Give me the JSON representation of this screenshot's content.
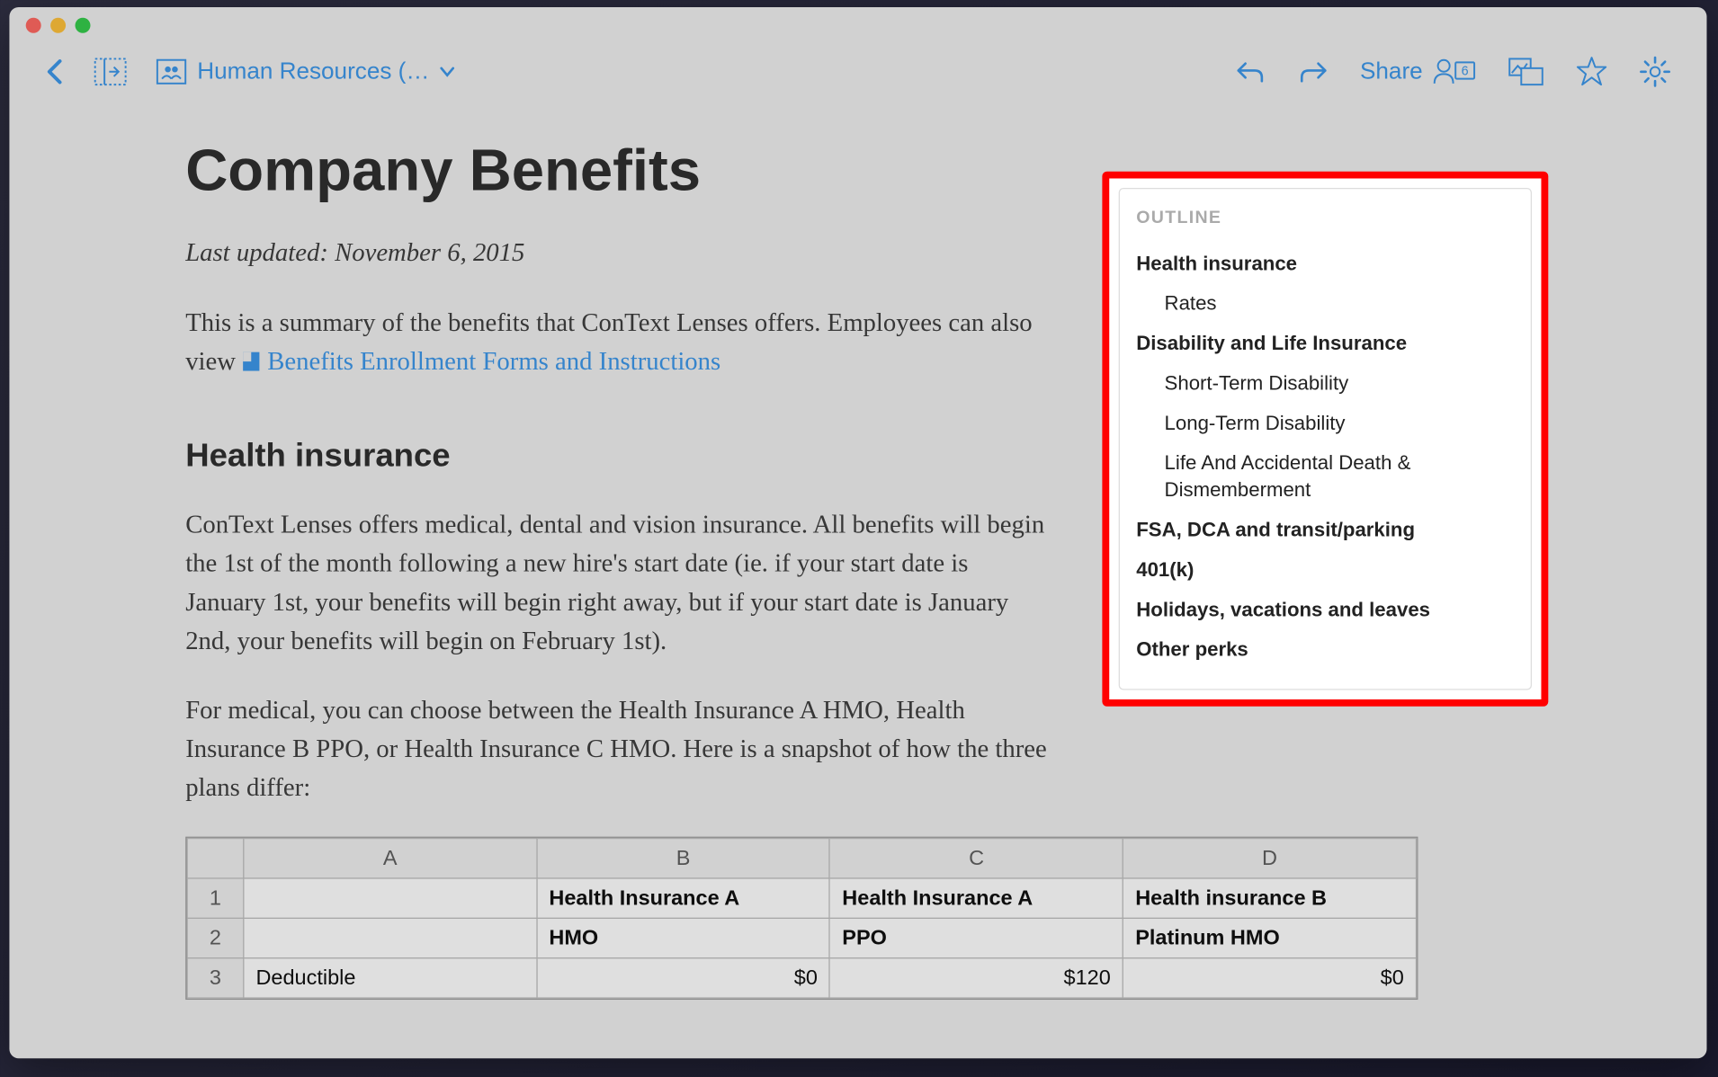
{
  "toolbar": {
    "breadcrumb": "Human Resources (…",
    "share_label": "Share",
    "share_count": "6"
  },
  "document": {
    "title": "Company Benefits",
    "last_updated": "Last updated: November 6, 2015",
    "intro_text_before": "This is a summary of the benefits that ConText Lenses offers. Employees can also view ",
    "intro_link": "Benefits Enrollment Forms and Instructions",
    "section1_heading": "Health insurance",
    "section1_p1": "ConText Lenses offers medical, dental and vision insurance. All benefits will begin the 1st of the month following a new hire's start date (ie. if your start date is January 1st, your benefits will begin right away, but if your start date is January 2nd, your benefits will begin on February 1st).",
    "section1_p2": "For medical, you can choose between the Health Insurance A HMO, Health Insurance B PPO, or Health Insurance C HMO. Here is a snapshot of how the three plans differ:"
  },
  "outline": {
    "title": "OUTLINE",
    "items": [
      {
        "label": "Health insurance",
        "level": 1
      },
      {
        "label": "Rates",
        "level": 2
      },
      {
        "label": "Disability and Life Insurance",
        "level": 1
      },
      {
        "label": "Short-Term Disability",
        "level": 2
      },
      {
        "label": "Long-Term Disability",
        "level": 2
      },
      {
        "label": "Life And Accidental Death & Dismemberment",
        "level": 2
      },
      {
        "label": "FSA, DCA and transit/parking",
        "level": 1
      },
      {
        "label": "401(k)",
        "level": 1
      },
      {
        "label": "Holidays, vacations and leaves",
        "level": 1
      },
      {
        "label": "Other perks",
        "level": 1
      }
    ]
  },
  "chart_data": {
    "type": "table",
    "columns": [
      "A",
      "B",
      "C",
      "D"
    ],
    "rows": [
      {
        "num": "1",
        "A": "",
        "B": "Health Insurance A",
        "C": "Health Insurance A",
        "D": "Health insurance B"
      },
      {
        "num": "2",
        "A": "",
        "B": "HMO",
        "C": "PPO",
        "D": "Platinum HMO"
      },
      {
        "num": "3",
        "A": "Deductible",
        "B": "$0",
        "C": "$120",
        "D": "$0"
      }
    ]
  }
}
